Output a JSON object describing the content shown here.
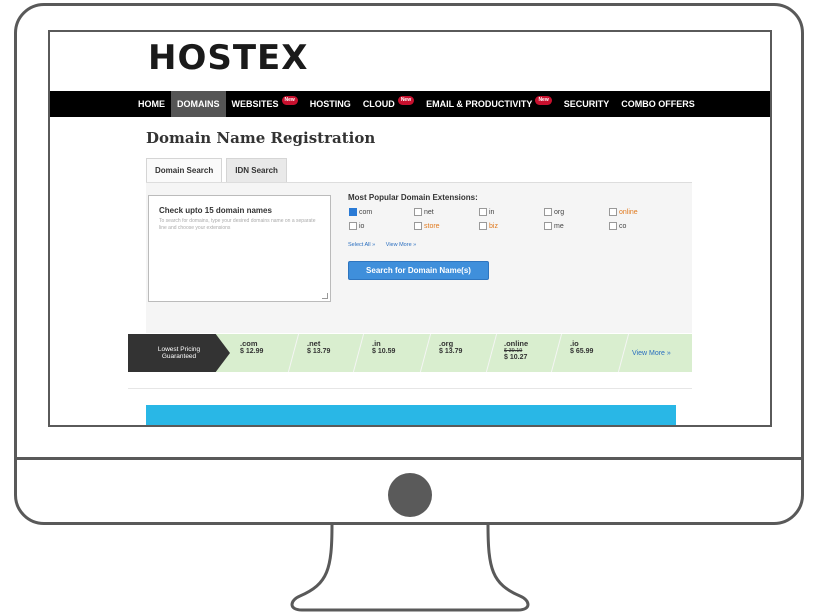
{
  "brand": {
    "logo_text": "HOSTEX",
    "accent": "#7ac143"
  },
  "nav": {
    "items": [
      {
        "label": "HOME",
        "badge": ""
      },
      {
        "label": "DOMAINS",
        "badge": ""
      },
      {
        "label": "WEBSITES",
        "badge": "New"
      },
      {
        "label": "HOSTING",
        "badge": ""
      },
      {
        "label": "CLOUD",
        "badge": "New"
      },
      {
        "label": "EMAIL & PRODUCTIVITY",
        "badge": "New"
      },
      {
        "label": "SECURITY",
        "badge": ""
      },
      {
        "label": "COMBO OFFERS",
        "badge": ""
      }
    ],
    "active": "DOMAINS"
  },
  "page": {
    "title": "Domain Name Registration"
  },
  "tabs": [
    {
      "label": "Domain Search"
    },
    {
      "label": "IDN Search"
    }
  ],
  "search_box": {
    "title": "Check upto 15 domain names",
    "hint": "To search for domains, type your desired domains name on a separate line and choose your extensions"
  },
  "extensions": {
    "heading": "Most Popular Domain Extensions:",
    "items": [
      {
        "label": "com",
        "checked": true,
        "highlight": false
      },
      {
        "label": "net",
        "checked": false,
        "highlight": false
      },
      {
        "label": "in",
        "checked": false,
        "highlight": false
      },
      {
        "label": "org",
        "checked": false,
        "highlight": false
      },
      {
        "label": "online",
        "checked": false,
        "highlight": true
      },
      {
        "label": "io",
        "checked": false,
        "highlight": false
      },
      {
        "label": "store",
        "checked": false,
        "highlight": true
      },
      {
        "label": "biz",
        "checked": false,
        "highlight": true
      },
      {
        "label": "me",
        "checked": false,
        "highlight": false
      },
      {
        "label": "co",
        "checked": false,
        "highlight": false
      }
    ],
    "select_all": "Select All »",
    "view_more": "View More »",
    "search_button": "Search for Domain Name(s)"
  },
  "pricing": {
    "label_line1": "Lowest Pricing",
    "label_line2": "Guaranteed",
    "items": [
      {
        "tld": ".com",
        "price": "$ 12.99",
        "old_price": ""
      },
      {
        "tld": ".net",
        "price": "$ 13.79",
        "old_price": ""
      },
      {
        "tld": ".in",
        "price": "$ 10.59",
        "old_price": ""
      },
      {
        "tld": ".org",
        "price": "$ 13.79",
        "old_price": ""
      },
      {
        "tld": ".online",
        "price": "$ 10.27",
        "old_price": "$ 39.19"
      },
      {
        "tld": ".io",
        "price": "$ 65.99",
        "old_price": ""
      }
    ],
    "view_more": "View More »"
  }
}
